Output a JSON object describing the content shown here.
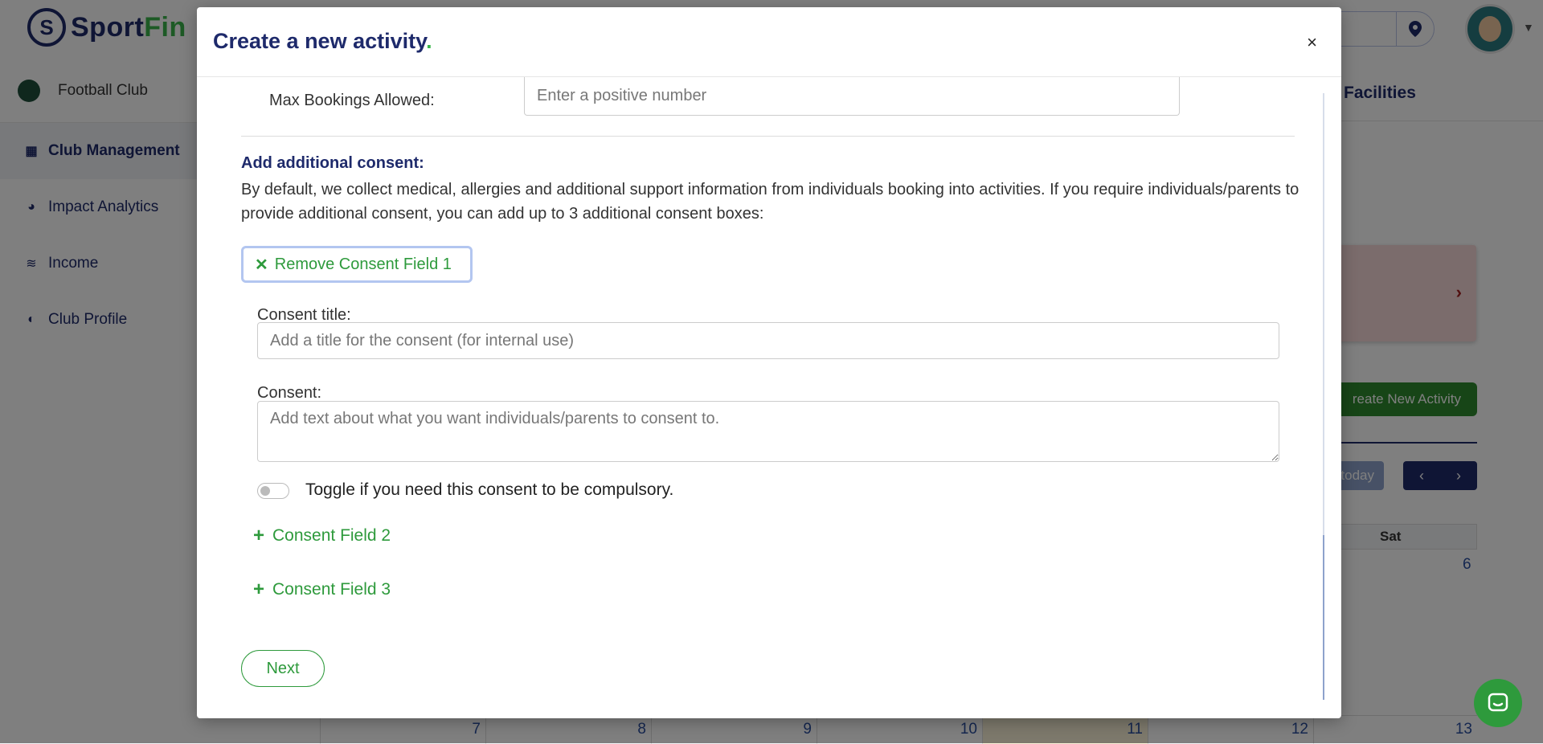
{
  "app": {
    "brand_main": "Sport",
    "brand_accent": "Fin",
    "club_name": "Football Club"
  },
  "sidebar": {
    "items": [
      {
        "label": "Club Management",
        "icon": "calendar-icon"
      },
      {
        "label": "Impact Analytics",
        "icon": "pie-chart-icon"
      },
      {
        "label": "Income",
        "icon": "coins-icon"
      },
      {
        "label": "Club Profile",
        "icon": "shield-icon"
      }
    ]
  },
  "main": {
    "facilities_tab": "Facilities",
    "create_button": "reate New Activity",
    "today_button": "today",
    "calendar_day_header": "Sat",
    "calendar_top_date": "6",
    "calendar_bottom_dates": [
      "7",
      "8",
      "9",
      "10",
      "11",
      "12",
      "13"
    ]
  },
  "modal": {
    "title": "Create a new activity",
    "title_dot": ".",
    "close": "×",
    "max_bookings_label": "Max Bookings Allowed:",
    "max_bookings_placeholder": "Enter a positive number",
    "consent_heading": "Add additional consent:",
    "consent_description": "By default, we collect medical, allergies and additional support information from individuals booking into activities. If you require individuals/parents to provide additional consent, you can add up to 3 additional consent boxes:",
    "remove_button": "Remove Consent Field 1",
    "consent_title_label": "Consent title:",
    "consent_title_placeholder": "Add a title for the consent (for internal use)",
    "consent_label": "Consent:",
    "consent_placeholder": "Add text about what you want individuals/parents to consent to.",
    "toggle_label": "Toggle if you need this consent to be compulsory.",
    "toggle_on": false,
    "add_field_2": "Consent Field 2",
    "add_field_3": "Consent Field 3",
    "next_button": "Next"
  },
  "colors": {
    "brand_navy": "#1e2a6b",
    "brand_green": "#3ab54a",
    "action_green": "#2e9a3c"
  }
}
